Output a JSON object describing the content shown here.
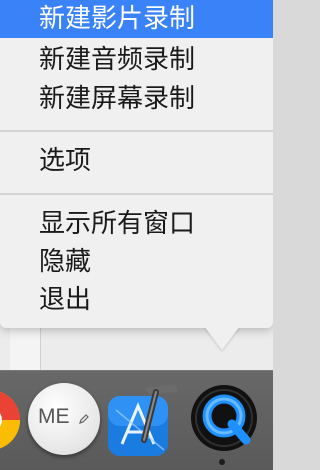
{
  "menu": {
    "items": [
      {
        "label": "新建影片录制",
        "selected": true
      },
      {
        "label": "新建音频录制",
        "selected": false
      },
      {
        "label": "新建屏幕录制",
        "selected": false
      },
      {
        "label": "选项",
        "selected": false
      },
      {
        "label": "显示所有窗口",
        "selected": false
      },
      {
        "label": "隐藏",
        "selected": false
      },
      {
        "label": "退出",
        "selected": false
      }
    ]
  },
  "dock": {
    "apps": [
      {
        "icon": "chrome-icon"
      },
      {
        "icon": "me-app-icon",
        "text": "ME"
      },
      {
        "icon": "xcode-icon"
      },
      {
        "icon": "quicktime-icon",
        "running": true
      }
    ]
  },
  "colors": {
    "selection": "#3a82f7",
    "menu_bg": "#f0f0f0",
    "dock_bg": "#5f5f5f"
  }
}
